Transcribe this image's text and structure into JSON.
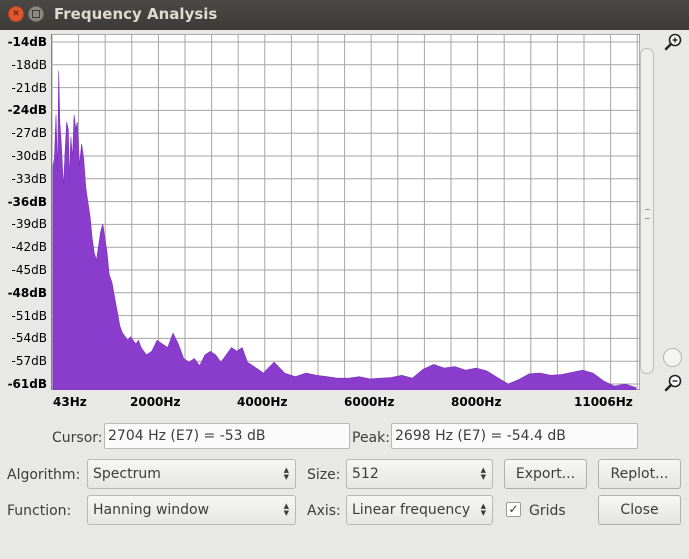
{
  "window": {
    "title": "Frequency Analysis"
  },
  "y_axis_labels": [
    "-14dB",
    "-18dB",
    "-21dB",
    "-24dB",
    "-27dB",
    "-30dB",
    "-33dB",
    "-36dB",
    "-39dB",
    "-42dB",
    "-45dB",
    "-48dB",
    "-51dB",
    "-54dB",
    "-57dB",
    "-61dB"
  ],
  "y_axis_bold": [
    true,
    false,
    false,
    true,
    false,
    false,
    false,
    true,
    false,
    false,
    false,
    true,
    false,
    false,
    false,
    true
  ],
  "x_axis_labels": [
    "43Hz",
    "2000Hz",
    "4000Hz",
    "6000Hz",
    "8000Hz",
    "11006Hz"
  ],
  "colors": {
    "spectrum_fill": "#8a3ccc",
    "plot_bg": "#ffffff",
    "grid": "#a6a6a6"
  },
  "chart_data": {
    "type": "area",
    "x_scale": "linear",
    "xlim": [
      43,
      11006
    ],
    "ylim": [
      -61,
      -14
    ],
    "grid": true,
    "x": [
      43,
      70,
      100,
      130,
      150,
      170,
      200,
      240,
      270,
      300,
      330,
      350,
      380,
      410,
      440,
      470,
      500,
      540,
      580,
      620,
      660,
      700,
      740,
      780,
      820,
      860,
      900,
      940,
      980,
      1020,
      1060,
      1100,
      1150,
      1200,
      1250,
      1300,
      1350,
      1400,
      1450,
      1500,
      1550,
      1600,
      1650,
      1700,
      1750,
      1800,
      1900,
      2000,
      2100,
      2200,
      2300,
      2400,
      2500,
      2600,
      2700,
      2800,
      2900,
      3000,
      3100,
      3200,
      3300,
      3400,
      3500,
      3600,
      3700,
      3800,
      3900,
      4000,
      4200,
      4400,
      4600,
      4800,
      5000,
      5200,
      5400,
      5600,
      5800,
      6000,
      6200,
      6400,
      6600,
      6800,
      7000,
      7200,
      7400,
      7600,
      7800,
      8000,
      8200,
      8400,
      8600,
      8800,
      9000,
      9200,
      9400,
      9600,
      9800,
      10000,
      10200,
      10400,
      10600,
      10800,
      11006
    ],
    "y": [
      -31,
      -30,
      -24,
      -32,
      -18,
      -25,
      -28,
      -34,
      -29,
      -25,
      -26,
      -33,
      -27,
      -30,
      -24,
      -26,
      -25,
      -31,
      -28,
      -30,
      -34,
      -36,
      -38,
      -41,
      -43,
      -44,
      -42,
      -40,
      -39,
      -41,
      -43,
      -46,
      -47,
      -49,
      -51,
      -53,
      -54,
      -54.5,
      -55,
      -54.5,
      -55,
      -55.5,
      -55,
      -56,
      -56.5,
      -57,
      -56.5,
      -55,
      -55.5,
      -56,
      -54,
      -55.5,
      -57.5,
      -58,
      -57.5,
      -58.5,
      -57,
      -56.5,
      -57,
      -58,
      -57,
      -56,
      -56.5,
      -56,
      -58,
      -58.5,
      -59,
      -59.5,
      -58,
      -59.5,
      -60,
      -59.5,
      -59.8,
      -60,
      -60.2,
      -60.2,
      -60,
      -60.3,
      -60.2,
      -60.1,
      -59.8,
      -60.2,
      -59,
      -58.3,
      -58.8,
      -58.6,
      -59.1,
      -58.8,
      -59.2,
      -60.1,
      -61,
      -60.4,
      -59.6,
      -59.5,
      -59.8,
      -59.7,
      -59.4,
      -59.1,
      -59.5,
      -60.6,
      -61.3,
      -61,
      -61.5
    ]
  },
  "cursor": {
    "label": "Cursor:",
    "value": "2704 Hz (E7) = -53 dB"
  },
  "peak": {
    "label": "Peak:",
    "value": "2698 Hz (E7) = -54.4 dB"
  },
  "algorithm": {
    "label": "Algorithm:",
    "value": "Spectrum"
  },
  "size": {
    "label": "Size:",
    "value": "512"
  },
  "function": {
    "label": "Function:",
    "value": "Hanning window"
  },
  "axis": {
    "label": "Axis:",
    "value": "Linear frequency"
  },
  "grids": {
    "label": "Grids",
    "checked": true
  },
  "buttons": {
    "export": "Export...",
    "replot": "Replot...",
    "close": "Close"
  },
  "icons": {
    "zoom_in": "zoom-in-icon",
    "zoom_out": "zoom-out-icon",
    "window_close": "close-icon",
    "window_min": "minimize-icon"
  }
}
